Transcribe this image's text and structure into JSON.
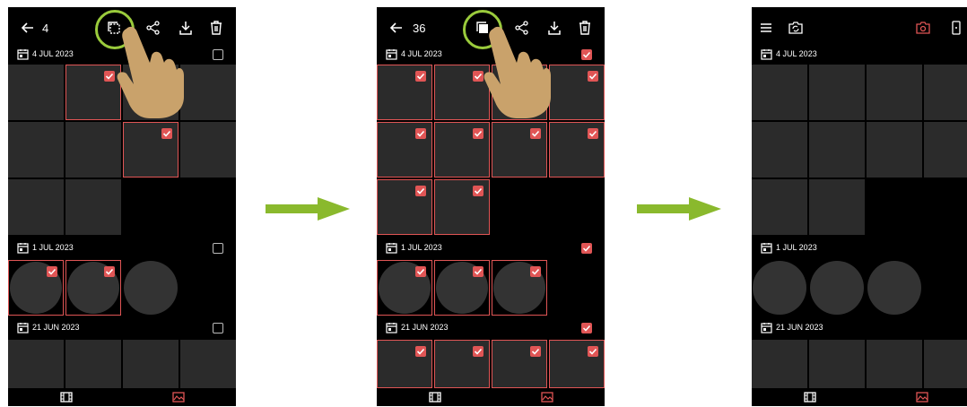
{
  "colors": {
    "accent": "#e05555",
    "arrow": "#8ab92d",
    "ring": "#9acb3c"
  },
  "panel1": {
    "selected_count": "4",
    "sections": [
      {
        "date": "4 JUL 2023"
      },
      {
        "date": "1 JUL 2023"
      },
      {
        "date": "21 JUN 2023"
      }
    ]
  },
  "panel2": {
    "selected_count": "36",
    "sections": [
      {
        "date": "4 JUL 2023"
      },
      {
        "date": "1 JUL 2023"
      },
      {
        "date": "21 JUN 2023"
      }
    ]
  },
  "panel3": {
    "sections": [
      {
        "date": "4 JUL 2023"
      },
      {
        "date": "1 JUL 2023"
      },
      {
        "date": "21 JUN 2023"
      }
    ]
  },
  "icons": {
    "back": "arrow-left-icon",
    "select_all": "select-all-icon",
    "share": "share-icon",
    "download": "download-icon",
    "delete": "trash-icon",
    "menu": "hamburger-menu-icon",
    "camera_switch": "camera-switch-icon",
    "camera": "camera-icon",
    "phone": "phone-icon",
    "video": "film-icon",
    "photo": "image-icon",
    "calendar": "calendar-icon",
    "hand": "pointing-hand-icon"
  }
}
